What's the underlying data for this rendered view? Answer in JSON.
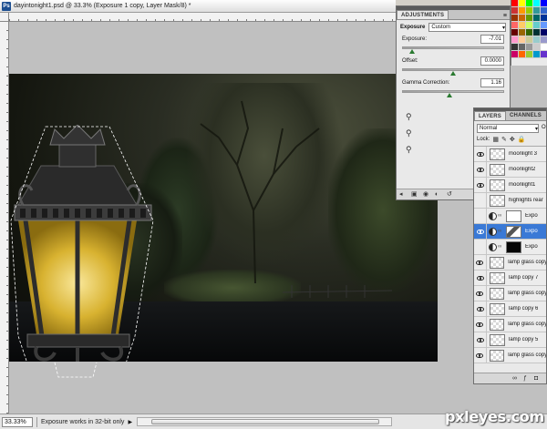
{
  "document": {
    "title": "dayintonight1.psd @ 33.3% (Exposure 1 copy, Layer Mask/8) *",
    "app_icon": "Ps"
  },
  "status": {
    "zoom": "33.33%",
    "message": "Exposure works in 32-bit only"
  },
  "adjustments": {
    "tab_label": "ADJUSTMENTS",
    "preset_label": "Exposure",
    "preset_value": "Custom",
    "exposure_label": "Exposure:",
    "exposure_value": "-7.01",
    "exposure_level": 0.08,
    "offset_label": "Offset:",
    "offset_value": "0.0000",
    "offset_level": 0.5,
    "gamma_label": "Gamma Correction:",
    "gamma_value": "1.16",
    "gamma_level": 0.46
  },
  "layers": {
    "tab_label": "LAYERS",
    "channels_tab_label": "CHANNELS",
    "blend_mode": "Normal",
    "opacity_label": "Op",
    "lock_label": "Lock:",
    "items": [
      {
        "name": "moonlight 3",
        "visible": true,
        "kind": "pixel",
        "selected": false
      },
      {
        "name": "moonlight2",
        "visible": true,
        "kind": "pixel",
        "selected": false
      },
      {
        "name": "moonlight1",
        "visible": true,
        "kind": "pixel",
        "selected": false
      },
      {
        "name": "highlights rear",
        "visible": false,
        "kind": "pixel",
        "selected": false
      },
      {
        "name": "Expo",
        "visible": false,
        "kind": "adjustment-white",
        "selected": false
      },
      {
        "name": "Expo",
        "visible": true,
        "kind": "adjustment-mixed",
        "selected": true
      },
      {
        "name": "Expo",
        "visible": false,
        "kind": "adjustment-dark",
        "selected": false
      },
      {
        "name": "lamp glass copy",
        "visible": true,
        "kind": "pixel",
        "selected": false
      },
      {
        "name": "lamp copy 7",
        "visible": true,
        "kind": "pixel",
        "selected": false
      },
      {
        "name": "lamp glass copy",
        "visible": true,
        "kind": "pixel",
        "selected": false
      },
      {
        "name": "lamp copy 6",
        "visible": true,
        "kind": "pixel",
        "selected": false
      },
      {
        "name": "lamp glass copy",
        "visible": true,
        "kind": "pixel",
        "selected": false
      },
      {
        "name": "lamp copy 5",
        "visible": true,
        "kind": "pixel",
        "selected": false
      },
      {
        "name": "lamp glass copy",
        "visible": true,
        "kind": "pixel",
        "selected": false
      }
    ]
  },
  "swatch_colors": [
    "#ff0000",
    "#ffff00",
    "#00ff00",
    "#00ffff",
    "#0000ff",
    "#cc3333",
    "#ff9900",
    "#99cc00",
    "#339999",
    "#3366cc",
    "#993300",
    "#cc6600",
    "#669900",
    "#006666",
    "#003399",
    "#ff6666",
    "#ffcc66",
    "#ccff66",
    "#66cccc",
    "#6699ff",
    "#660000",
    "#996600",
    "#336600",
    "#003333",
    "#000066",
    "#ff99cc",
    "#ffcc99",
    "#cccc99",
    "#99cccc",
    "#9999cc",
    "#333333",
    "#666666",
    "#999999",
    "#cccccc",
    "#ffffff",
    "#cc0066",
    "#ff6600",
    "#99cc33",
    "#0099cc",
    "#6633cc"
  ],
  "watermark": "pxleyes.com"
}
